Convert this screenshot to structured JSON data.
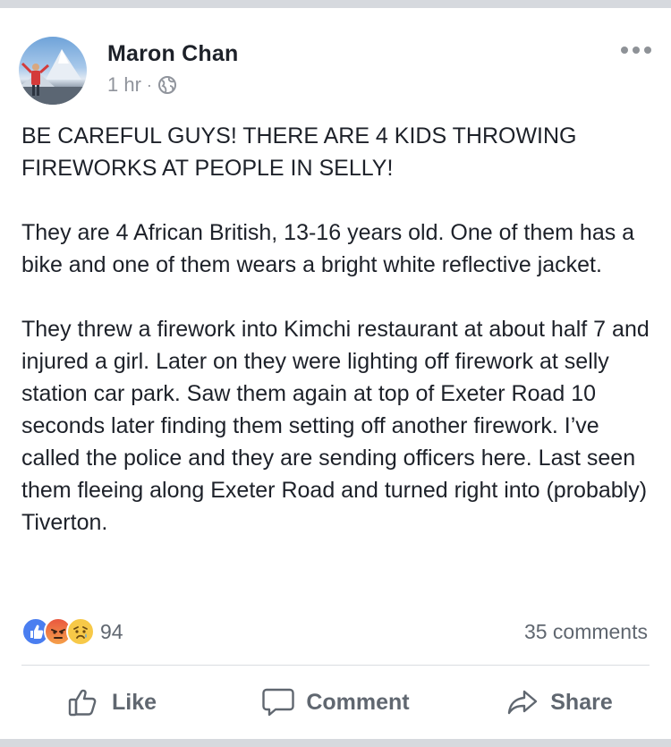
{
  "post": {
    "author": "Maron Chan",
    "time": "1 hr",
    "separator": "·",
    "paragraphs": [
      "BE CAREFUL GUYS! THERE ARE 4 KIDS THROWING FIREWORKS AT PEOPLE IN SELLY!",
      "They are 4 African British, 13-16 years old. One of them has a bike and one of them wears a bright white reflective jacket.",
      "They threw a firework into Kimchi restaurant at about half 7 and injured a girl. Later on they were lighting off firework at selly station car park. Saw them again at top of Exeter Road 10 seconds later finding them setting off another firework. I’ve called the police and they are sending officers here. Last seen them fleeing along Exeter Road and turned right into (probably) Tiverton."
    ]
  },
  "engagement": {
    "reaction_count": "94",
    "comment_count": "35 comments",
    "reaction_icons": [
      "like-reaction-icon",
      "angry-reaction-icon",
      "sad-reaction-icon"
    ]
  },
  "actions": {
    "like_label": "Like",
    "comment_label": "Comment",
    "share_label": "Share"
  },
  "colors": {
    "like_blue": "#4a7ef0",
    "angry_red": "#e9573f",
    "sad_yellow": "#f7c948",
    "text": "#1d2129",
    "muted": "#606770"
  }
}
